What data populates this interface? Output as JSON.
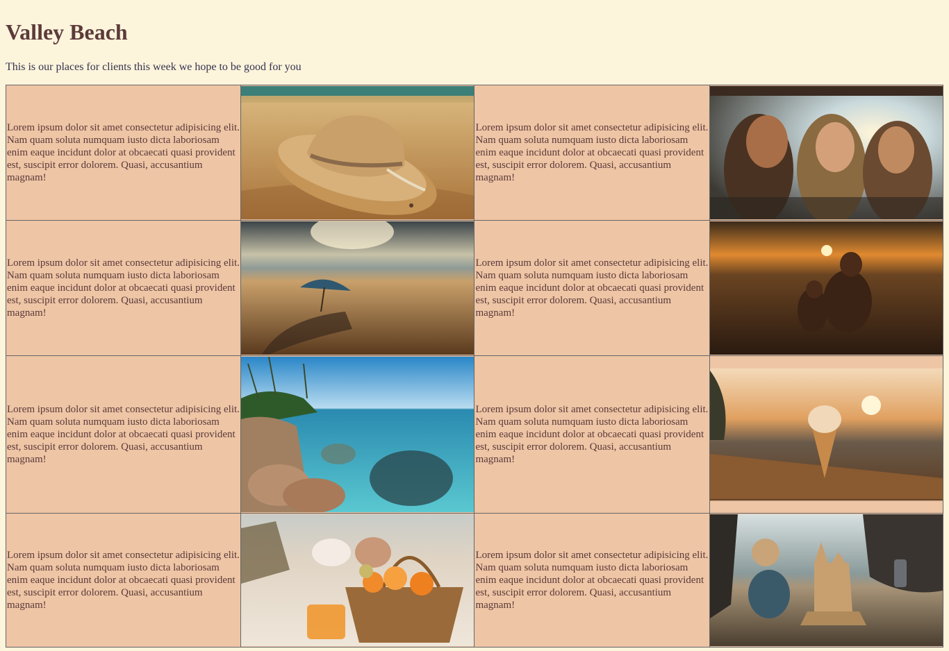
{
  "page": {
    "title": "Valley Beach",
    "subtitle": "This is our places for clients this week we hope to be good for you"
  },
  "rows": [
    {
      "left_text": "Lorem ipsum dolor sit amet consectetur adipisicing elit. Nam quam soluta numquam iusto dicta laboriosam enim eaque incidunt dolor at obcaecati quasi provident est, suscipit error dolorem. Quasi, accusantium magnam!",
      "left_image": "straw-hat-on-sand",
      "right_text": "Lorem ipsum dolor sit amet consectetur adipisicing elit. Nam quam soluta numquam iusto dicta laboriosam enim eaque incidunt dolor at obcaecati quasi provident est, suscipit error dolorem. Quasi, accusantium magnam!",
      "right_image": "three-women-smiling-sunset"
    },
    {
      "left_text": "Lorem ipsum dolor sit amet consectetur adipisicing elit. Nam quam soluta numquam iusto dicta laboriosam enim eaque incidunt dolor at obcaecati quasi provident est, suscipit error dolorem. Quasi, accusantium magnam!",
      "left_image": "beach-umbrella-footprints",
      "right_text": "Lorem ipsum dolor sit amet consectetur adipisicing elit. Nam quam soluta numquam iusto dicta laboriosam enim eaque incidunt dolor at obcaecati quasi provident est, suscipit error dolorem. Quasi, accusantium magnam!",
      "right_image": "mother-child-sunset"
    },
    {
      "left_text": "Lorem ipsum dolor sit amet consectetur adipisicing elit. Nam quam soluta numquam iusto dicta laboriosam enim eaque incidunt dolor at obcaecati quasi provident est, suscipit error dolorem. Quasi, accusantium magnam!",
      "left_image": "tropical-lagoon-rocks",
      "right_text": "Lorem ipsum dolor sit amet consectetur adipisicing elit. Nam quam soluta numquam iusto dicta laboriosam enim eaque incidunt dolor at obcaecati quasi provident est, suscipit error dolorem. Quasi, accusantium magnam!",
      "right_image": "ice-cream-on-dock"
    },
    {
      "left_text": "Lorem ipsum dolor sit amet consectetur adipisicing elit. Nam quam soluta numquam iusto dicta laboriosam enim eaque incidunt dolor at obcaecati quasi provident est, suscipit error dolorem. Quasi, accusantium magnam!",
      "left_image": "picnic-basket-oranges",
      "right_text": "Lorem ipsum dolor sit amet consectetur adipisicing elit. Nam quam soluta numquam iusto dicta laboriosam enim eaque incidunt dolor at obcaecati quasi provident est, suscipit error dolorem. Quasi, accusantium magnam!",
      "right_image": "child-sandcastle"
    }
  ],
  "colors": {
    "background": "#fdf4dc",
    "cell": "#eec5a5",
    "title": "#5c3a3a",
    "text": "#5a3a3a"
  }
}
